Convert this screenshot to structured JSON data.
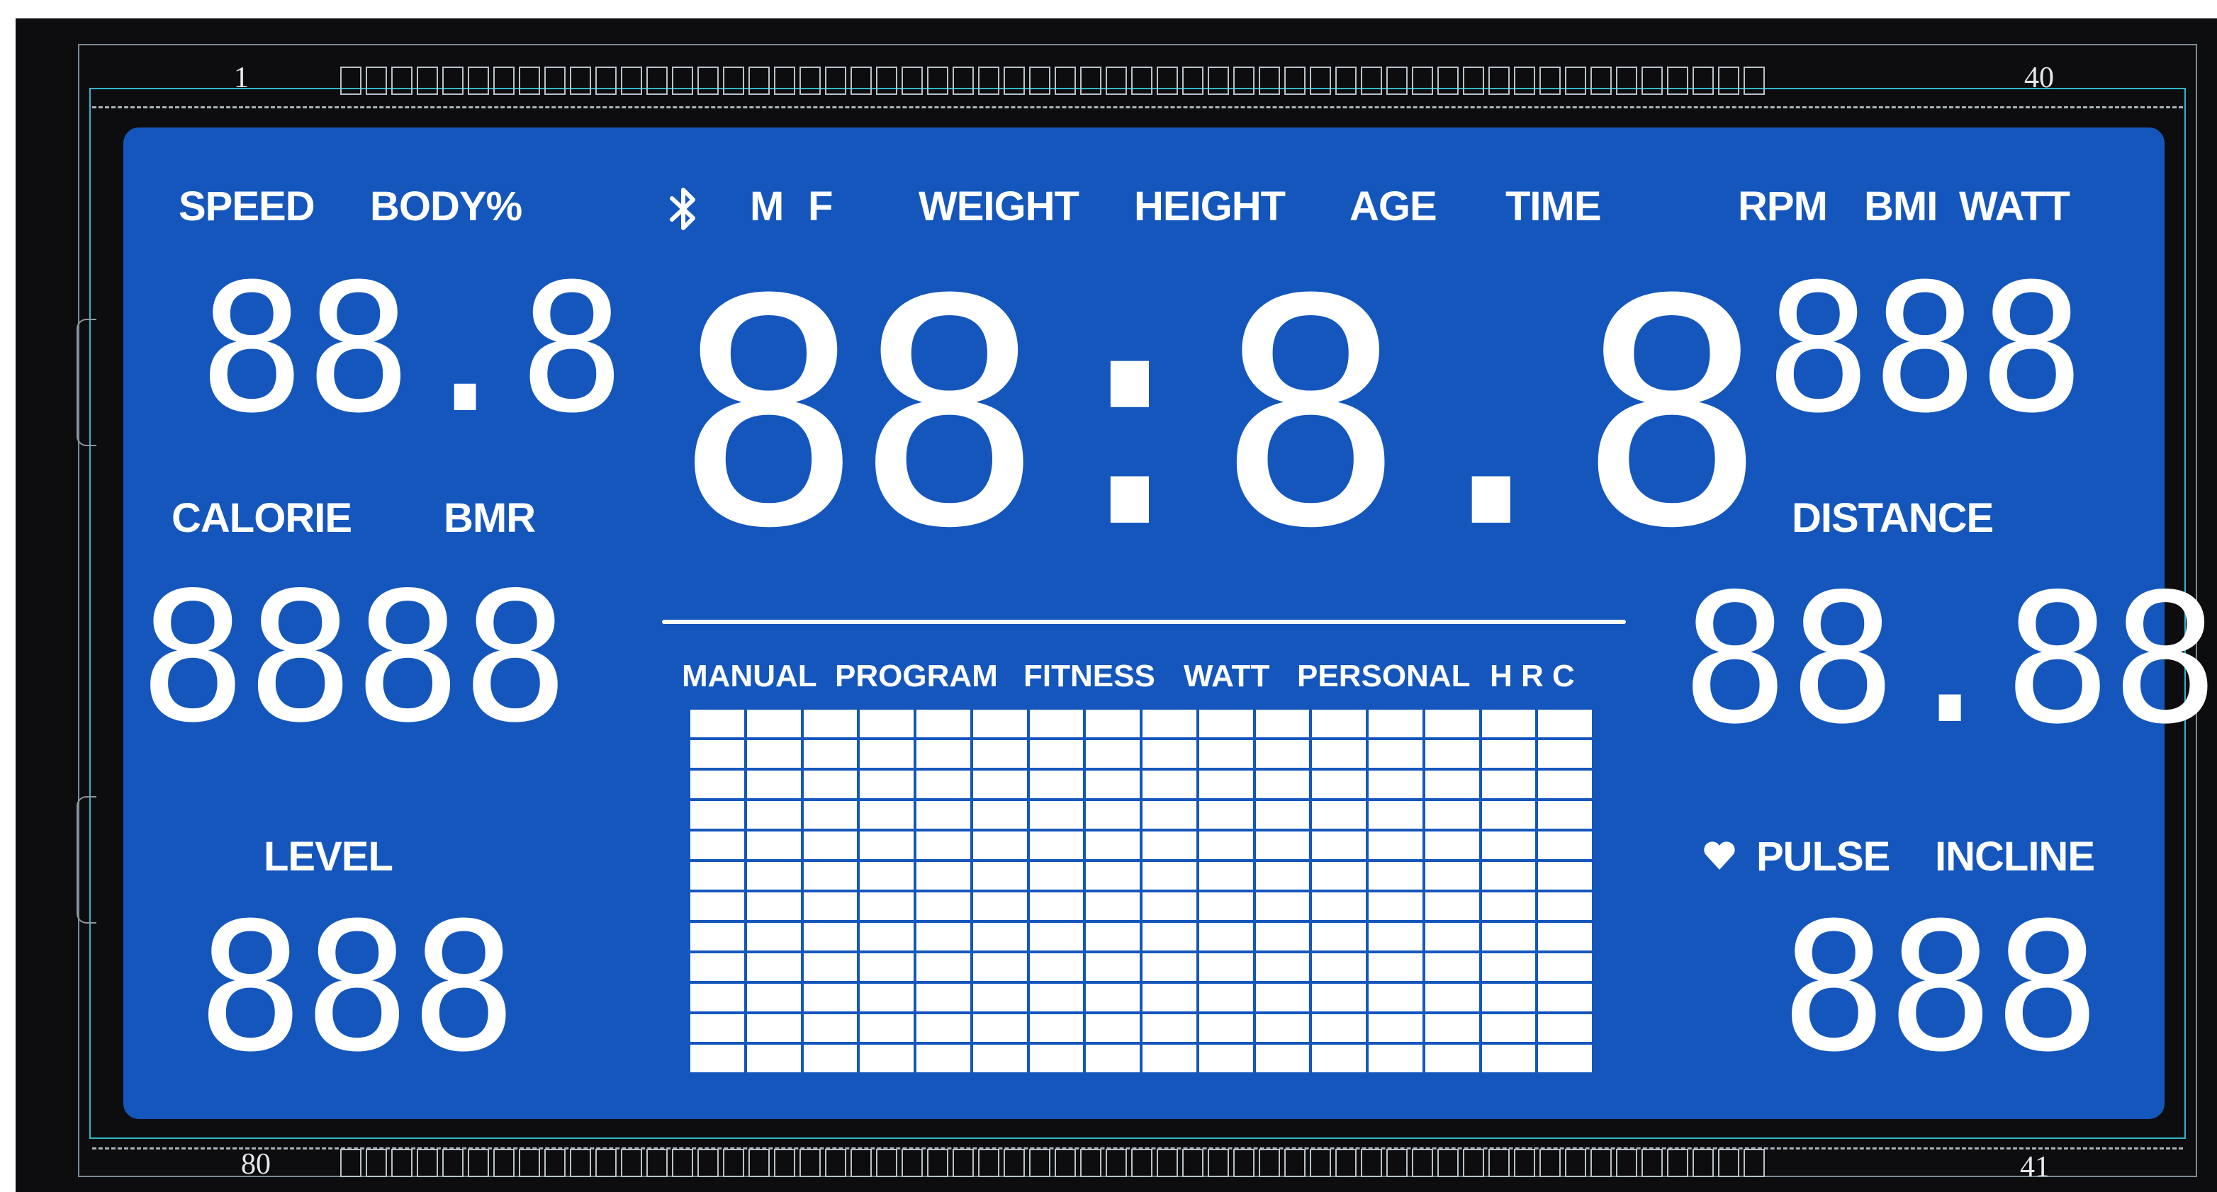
{
  "pins": {
    "top_left": "1",
    "top_right": "40",
    "bottom_left": "80",
    "bottom_right": "41"
  },
  "labels": {
    "speed": "SPEED",
    "body_pct": "BODY%",
    "m": "M",
    "f": "F",
    "weight": "WEIGHT",
    "height": "HEIGHT",
    "age": "AGE",
    "time": "TIME",
    "rpm": "RPM",
    "bmi": "BMI",
    "watt": "WATT",
    "calorie": "CALORIE",
    "bmr": "BMR",
    "distance": "DISTANCE",
    "level": "LEVEL",
    "pulse": "PULSE",
    "incline": "INCLINE"
  },
  "modes": [
    "MANUAL",
    "PROGRAM",
    "FITNESS",
    "WATT",
    "PERSONAL",
    "H R C"
  ],
  "readouts": {
    "speed_body": "88.8",
    "main_time": "88:8.8",
    "rpm_bmi_watt": "888",
    "calorie_bmr": "8888",
    "distance": "88.88",
    "level": "888",
    "pulse_incline": "888"
  },
  "icons": {
    "bluetooth": "bluetooth-icon",
    "heart": "heart-icon"
  },
  "colors": {
    "lcd_background": "#1456bc",
    "segment": "#ffffff",
    "bezel": "#0d0d10"
  },
  "matrix": {
    "columns": 16,
    "rows": 12
  }
}
